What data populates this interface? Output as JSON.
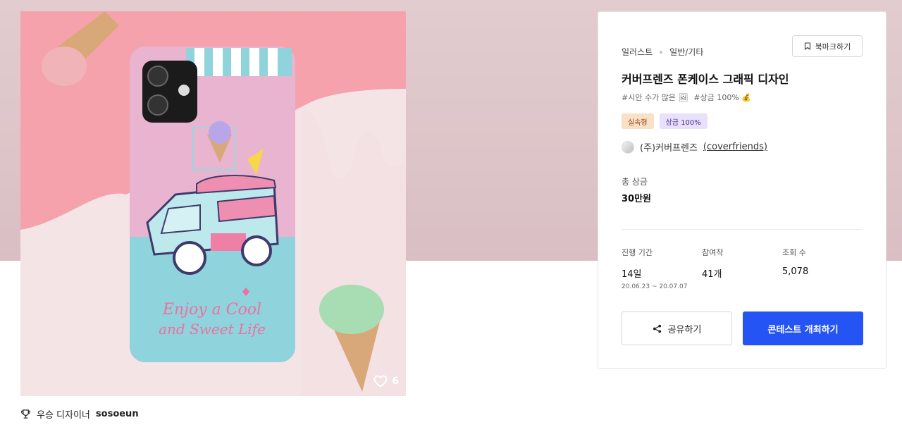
{
  "colors": {
    "accent": "#2554f5",
    "hero_bg": "#dcc4c8",
    "badge_orange": "#fbe0c8",
    "badge_purple": "#e9e1fb"
  },
  "product": {
    "phone_text_line1": "Enjoy a Cool",
    "phone_text_line2": "and Sweet Life",
    "like_count": "6",
    "like_icon": "heart-icon"
  },
  "winner": {
    "icon": "trophy-icon",
    "label": "우승 디자이너",
    "name": "sosoeun"
  },
  "card": {
    "breadcrumb": [
      "일러스트",
      "일반/기타"
    ],
    "bookmark_label": "북마크하기",
    "title": "커버프렌즈 폰케이스 그래픽 디자인",
    "tags": [
      "#시안 수가 많은 🖼",
      "#상금 100% 💰"
    ],
    "badges": [
      "실속형",
      "상금 100%"
    ],
    "host_name": "(주)커버프렌즈",
    "host_handle": "(coverfriends)",
    "prize_label": "총 상금",
    "prize_value": "30만원",
    "stats": [
      {
        "label": "진행 기간",
        "value": "14일",
        "sub": "20.06.23 ~ 20.07.07"
      },
      {
        "label": "참여작",
        "value": "41개",
        "sub": ""
      },
      {
        "label": "조회 수",
        "value": "5,078",
        "sub": ""
      }
    ],
    "share_label": "공유하기",
    "host_button_label": "콘테스트 개최하기"
  }
}
